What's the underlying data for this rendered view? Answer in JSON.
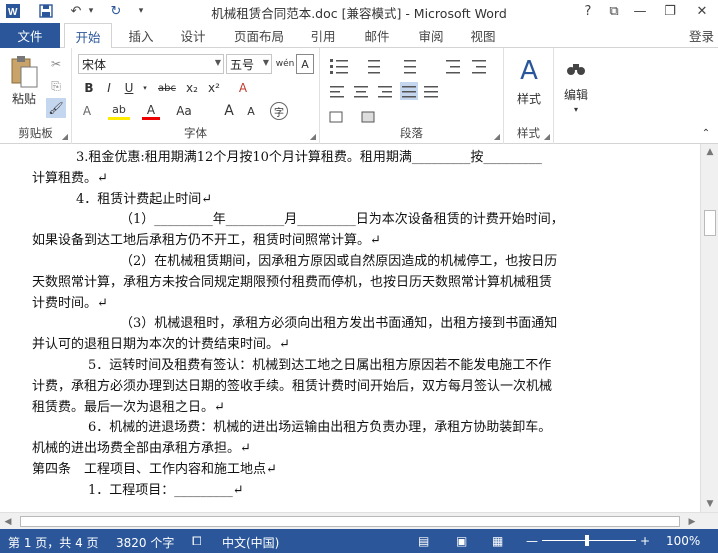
{
  "window": {
    "title": "机械租赁合同范本.doc [兼容模式] - Microsoft Word",
    "help": "?",
    "ribbon_options": "⧉",
    "minimize": "—",
    "restore": "❐",
    "close": "✕"
  },
  "quick_access": {
    "app_icon": "W",
    "save": "💾",
    "undo": "↶",
    "undo_arrow": "▾",
    "redo": "↻",
    "customize": "▾"
  },
  "tabs": {
    "file": "文件",
    "items": [
      "开始",
      "插入",
      "设计",
      "页面布局",
      "引用",
      "邮件",
      "审阅",
      "视图"
    ],
    "login": "登录"
  },
  "ribbon": {
    "clipboard": {
      "label": "剪贴板",
      "paste": "粘贴",
      "cut": "✂",
      "copy": "⎘",
      "format_painter": "🖌"
    },
    "font": {
      "label": "字体",
      "font_name": "宋体",
      "font_size": "五号",
      "wen": "wén",
      "bold": "B",
      "italic": "I",
      "underline": "U",
      "strike": "abc",
      "subscript": "x₂",
      "superscript": "x²",
      "clear": "A",
      "highlight": "ab",
      "font_color": "A",
      "change_case": "Aa",
      "grow": "A",
      "shrink": "A",
      "char_border": "A",
      "enclose": "字"
    },
    "paragraph": {
      "label": "段落"
    },
    "styles": {
      "label": "样式",
      "button": "样式"
    },
    "editing": {
      "button": "编辑"
    }
  },
  "document": {
    "paragraphs": [
      {
        "cls": "h4",
        "text": "3.租金优惠:租用期满12个月按10个月计算租费。租用期满_________按_________"
      },
      {
        "cls": "",
        "text": "计算租费。↵"
      },
      {
        "cls": "h4",
        "text": "4．租赁计费起止时间↵"
      },
      {
        "cls": "i2",
        "text": "（1）_________年_________月_________日为本次设备租赁的计费开始时间，"
      },
      {
        "cls": "",
        "text": "如果设备到达工地后承租方仍不开工，租赁时间照常计算。↵"
      },
      {
        "cls": "i2",
        "text": "（2）在机械租赁期间，因承租方原因或自然原因造成的机械停工，也按日历"
      },
      {
        "cls": "",
        "text": "天数照常计算，承租方未按合同规定期限预付租费而停机，也按日历天数照常计算机械租赁"
      },
      {
        "cls": "",
        "text": "计费时间。↵"
      },
      {
        "cls": "i2",
        "text": "（3）机械退租时，承租方必须向出租方发出书面通知，出租方接到书面通知"
      },
      {
        "cls": "",
        "text": "并认可的退租日期为本次的计费结束时间。↵"
      },
      {
        "cls": "i1",
        "text": "5．运转时间及租费有签认：机械到达工地之日属出租方原因若不能发电施工不作"
      },
      {
        "cls": "",
        "text": "计费，承租方必须办理到达日期的签收手续。租赁计费时间开始后，双方每月签认一次机械"
      },
      {
        "cls": "",
        "text": "租赁费。最后一次为退租之日。↵"
      },
      {
        "cls": "i1",
        "text": "6．机械的进退场费：机械的进出场运输由出租方负责办理，承租方协助装卸车。"
      },
      {
        "cls": "",
        "text": "机械的进出场费全部由承租方承担。↵"
      },
      {
        "cls": "",
        "text": "第四条　工程项目、工作内容和施工地点↵"
      },
      {
        "cls": "i1",
        "text": "1．工程项目：_________↵"
      }
    ]
  },
  "status": {
    "page": "第 1 页，共 4 页",
    "words": "3820 个字",
    "proofing_icon": "⧠",
    "language": "中文(中国)",
    "zoom": "100%",
    "zoom_minus": "—",
    "zoom_plus": "+"
  }
}
